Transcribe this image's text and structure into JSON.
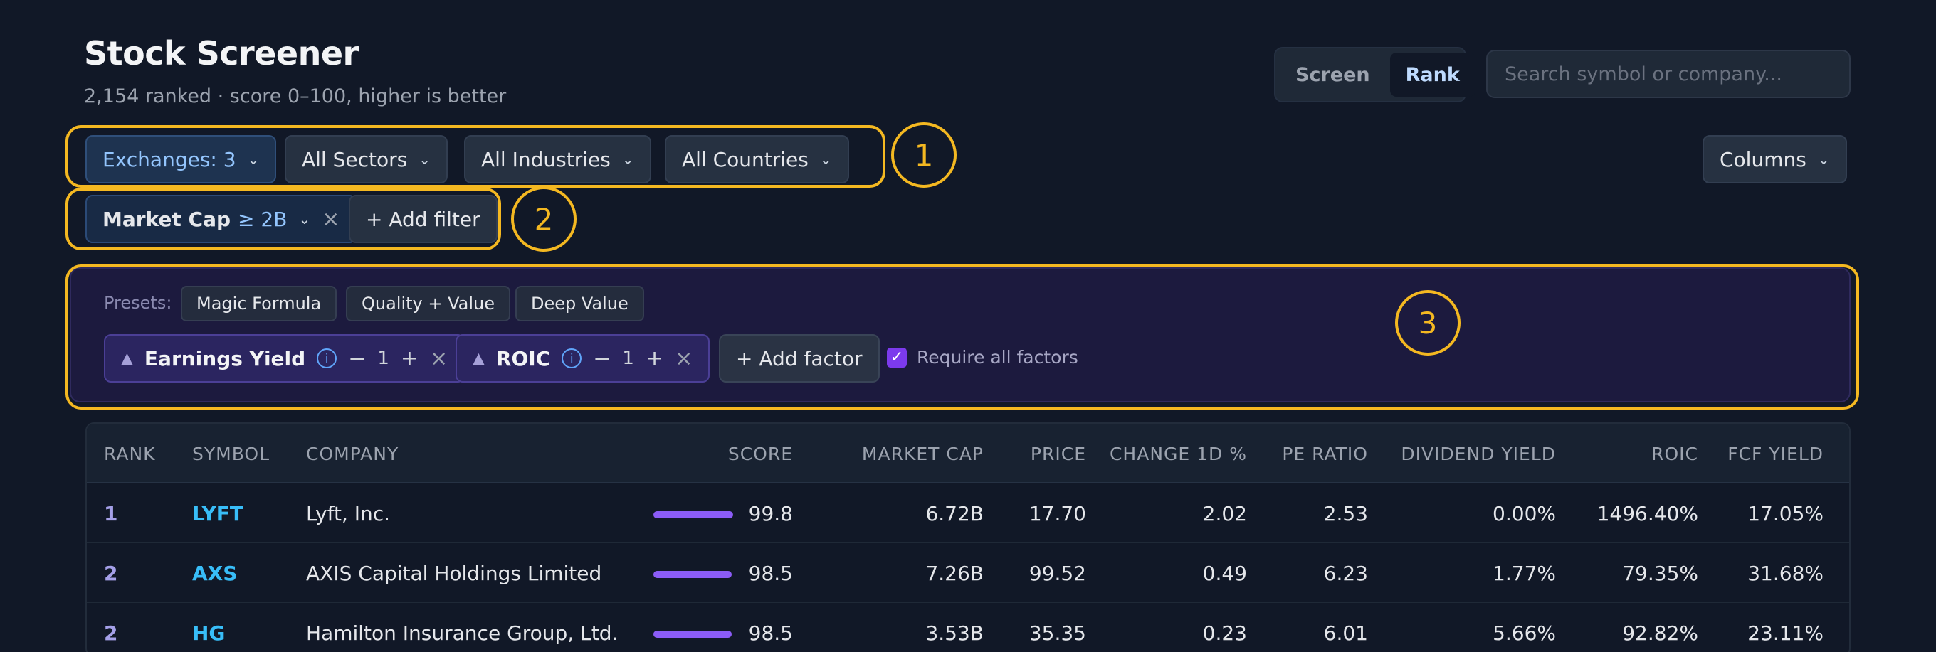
{
  "header": {
    "title": "Stock Screener",
    "subtitle": "2,154 ranked · score 0–100, higher is better"
  },
  "mode_toggle": {
    "screen": "Screen",
    "rank": "Rank",
    "active": "Rank"
  },
  "search": {
    "placeholder": "Search symbol or company..."
  },
  "filters": {
    "exchanges": "Exchanges: 3",
    "sectors": "All Sectors",
    "industries": "All Industries",
    "countries": "All Countries",
    "columns": "Columns"
  },
  "active_filters": {
    "market_cap_label": "Market Cap",
    "market_cap_value": "≥ 2B",
    "add_filter": "+ Add filter"
  },
  "annotations": [
    "1",
    "2",
    "3"
  ],
  "ranking": {
    "presets_label": "Presets:",
    "presets": [
      "Magic Formula",
      "Quality + Value",
      "Deep Value"
    ],
    "factors": [
      {
        "name": "Earnings Yield",
        "weight": "1"
      },
      {
        "name": "ROIC",
        "weight": "1"
      }
    ],
    "add_factor": "+ Add factor",
    "require_all": "Require all factors",
    "require_all_checked": true
  },
  "table": {
    "columns": [
      "RANK",
      "SYMBOL",
      "COMPANY",
      "SCORE",
      "MARKET CAP",
      "PRICE",
      "CHANGE 1D %",
      "PE RATIO",
      "DIVIDEND YIELD",
      "ROIC",
      "FCF YIELD"
    ],
    "rows": [
      {
        "rank": "1",
        "symbol": "LYFT",
        "company": "Lyft, Inc.",
        "score": "99.8",
        "score_value": 99.8,
        "market_cap": "6.72B",
        "price": "17.70",
        "change": "2.02",
        "pe": "2.53",
        "div": "0.00%",
        "roic": "1496.40%",
        "fcf": "17.05%"
      },
      {
        "rank": "2",
        "symbol": "AXS",
        "company": "AXIS Capital Holdings Limited",
        "score": "98.5",
        "score_value": 98.5,
        "market_cap": "7.26B",
        "price": "99.52",
        "change": "0.49",
        "pe": "6.23",
        "div": "1.77%",
        "roic": "79.35%",
        "fcf": "31.68%"
      },
      {
        "rank": "2",
        "symbol": "HG",
        "company": "Hamilton Insurance Group, Ltd.",
        "score": "98.5",
        "score_value": 98.5,
        "market_cap": "3.53B",
        "price": "35.35",
        "change": "0.23",
        "pe": "6.01",
        "div": "5.66%",
        "roic": "92.82%",
        "fcf": "23.11%"
      }
    ]
  },
  "colors": {
    "accent": "#8b5cf6",
    "link": "#38bdf8",
    "annotation": "#f4b821"
  }
}
